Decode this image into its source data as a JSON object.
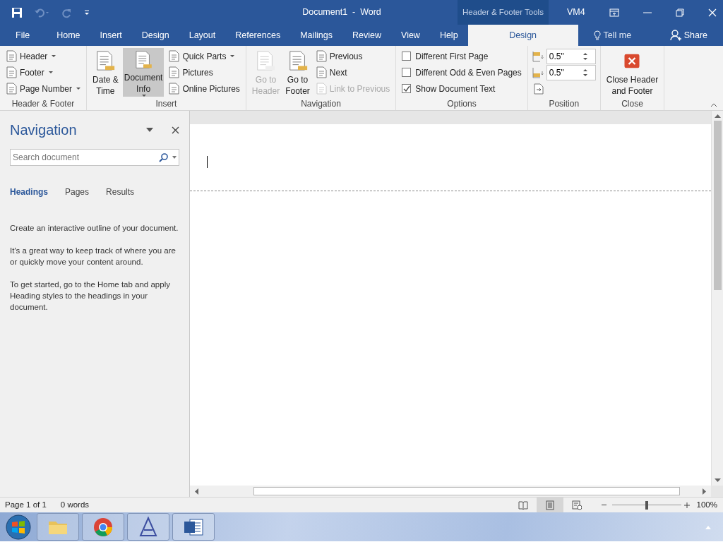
{
  "title_bar": {
    "title": "Document1  -  Word",
    "context_label": "Header & Footer Tools",
    "user": "VM4"
  },
  "tabs": [
    {
      "label": "File",
      "selected": false
    },
    {
      "label": "Home",
      "selected": false
    },
    {
      "label": "Insert",
      "selected": false
    },
    {
      "label": "Design",
      "selected": false
    },
    {
      "label": "Layout",
      "selected": false
    },
    {
      "label": "References",
      "selected": false
    },
    {
      "label": "Mailings",
      "selected": false
    },
    {
      "label": "Review",
      "selected": false
    },
    {
      "label": "View",
      "selected": false
    },
    {
      "label": "Help",
      "selected": false
    },
    {
      "label": "Design",
      "selected": true
    }
  ],
  "tell_me": "Tell me",
  "share": "Share",
  "ribbon_groups": [
    {
      "label": "Header & Footer",
      "columns": [
        [
          {
            "kind": "small",
            "label": "Header",
            "dropdown": true,
            "disabled": false
          },
          {
            "kind": "small",
            "label": "Footer",
            "dropdown": true,
            "disabled": false
          },
          {
            "kind": "small",
            "label": "Page Number",
            "dropdown": true,
            "disabled": false
          }
        ]
      ]
    },
    {
      "label": "Insert",
      "columns": [
        [
          {
            "kind": "large",
            "lines": [
              "Date &",
              "Time"
            ],
            "dropdown": false,
            "disabled": false,
            "selected": false
          }
        ],
        [
          {
            "kind": "large",
            "lines": [
              "Document",
              "Info"
            ],
            "dropdown": true,
            "disabled": false,
            "selected": true
          }
        ],
        [
          {
            "kind": "small",
            "label": "Quick Parts",
            "dropdown": true,
            "disabled": false
          },
          {
            "kind": "small",
            "label": "Pictures",
            "dropdown": false,
            "disabled": false
          },
          {
            "kind": "small",
            "label": "Online Pictures",
            "dropdown": false,
            "disabled": false
          }
        ]
      ]
    },
    {
      "label": "Navigation",
      "columns": [
        [
          {
            "kind": "large",
            "lines": [
              "Go to",
              "Header"
            ],
            "dropdown": false,
            "disabled": true,
            "selected": false
          }
        ],
        [
          {
            "kind": "large",
            "lines": [
              "Go to",
              "Footer"
            ],
            "dropdown": false,
            "disabled": false,
            "selected": false
          }
        ],
        [
          {
            "kind": "small",
            "label": "Previous",
            "dropdown": false,
            "disabled": false
          },
          {
            "kind": "small",
            "label": "Next",
            "dropdown": false,
            "disabled": false
          },
          {
            "kind": "small",
            "label": "Link to Previous",
            "dropdown": false,
            "disabled": true
          }
        ]
      ]
    },
    {
      "label": "Options",
      "columns": [
        [
          {
            "kind": "checkbox",
            "label": "Different First Page",
            "checked": false
          },
          {
            "kind": "checkbox",
            "label": "Different Odd & Even Pages",
            "checked": false
          },
          {
            "kind": "checkbox",
            "label": "Show Document Text",
            "checked": true
          }
        ]
      ]
    },
    {
      "label": "Position",
      "columns": [
        [
          {
            "kind": "spin",
            "value": "0.5\""
          },
          {
            "kind": "spin",
            "value": "0.5\""
          },
          {
            "kind": "icon"
          }
        ]
      ]
    },
    {
      "label": "Close",
      "columns": [
        [
          {
            "kind": "close",
            "lines": [
              "Close Header",
              "and Footer"
            ]
          }
        ]
      ]
    }
  ],
  "navigation": {
    "title": "Navigation",
    "search": {
      "placeholder": "Search document"
    },
    "tabs": [
      {
        "label": "Headings",
        "selected": true
      },
      {
        "label": "Pages",
        "selected": false
      },
      {
        "label": "Results",
        "selected": false
      }
    ],
    "paragraphs": [
      "Create an interactive outline of your document.",
      "It's a great way to keep track of where you are or quickly move your content around.",
      "To get started, go to the Home tab and apply Heading styles to the headings in your document."
    ]
  },
  "status_bar": {
    "page": "Page 1 of 1",
    "words": "0 words",
    "views": [
      {
        "selected": false
      },
      {
        "selected": true
      },
      {
        "selected": false
      }
    ],
    "zoom": {
      "level": 0.5,
      "label": "100%"
    }
  }
}
